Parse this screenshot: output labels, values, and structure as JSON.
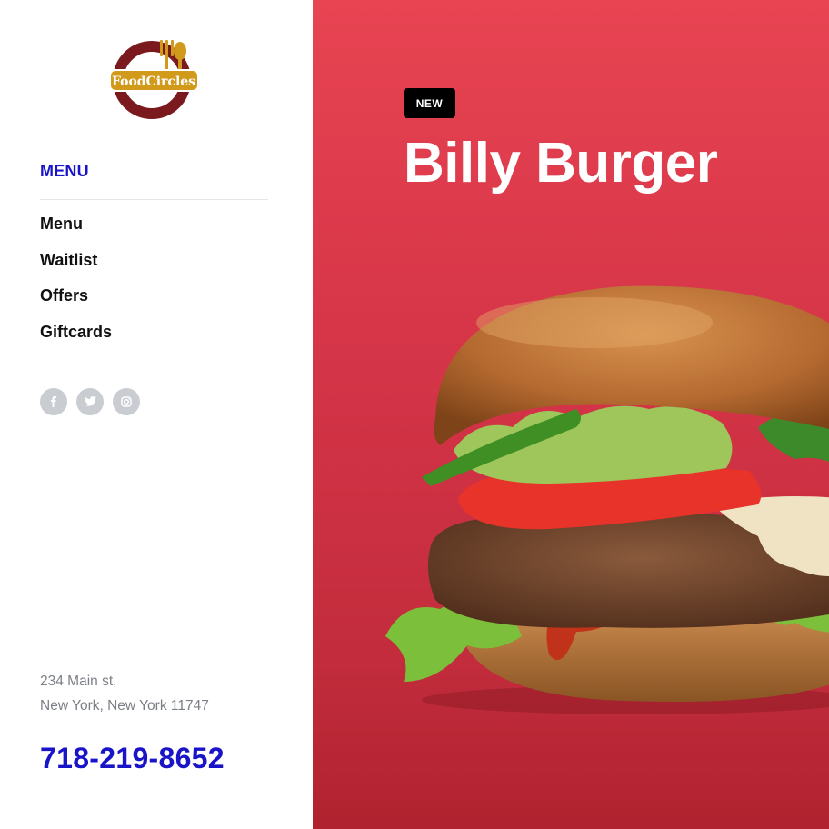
{
  "brand": {
    "name": "FoodCircles"
  },
  "sidebar": {
    "heading": "MENU",
    "items": [
      {
        "label": "Menu"
      },
      {
        "label": "Waitlist"
      },
      {
        "label": "Offers"
      },
      {
        "label": "Giftcards"
      }
    ],
    "social": [
      "facebook-icon",
      "twitter-icon",
      "instagram-icon"
    ],
    "address": {
      "line1": "234 Main st,",
      "line2": "New York, New York 11747"
    },
    "phone": "718-219-8652"
  },
  "hero": {
    "badge": "NEW",
    "title": "Billy Burger",
    "image": "burger-image"
  },
  "colors": {
    "accent": "#1a14c8",
    "hero_top": "#e84452",
    "hero_bottom": "#b0222f",
    "logo_ring": "#7a1a1f",
    "logo_gold": "#d19a1a"
  }
}
